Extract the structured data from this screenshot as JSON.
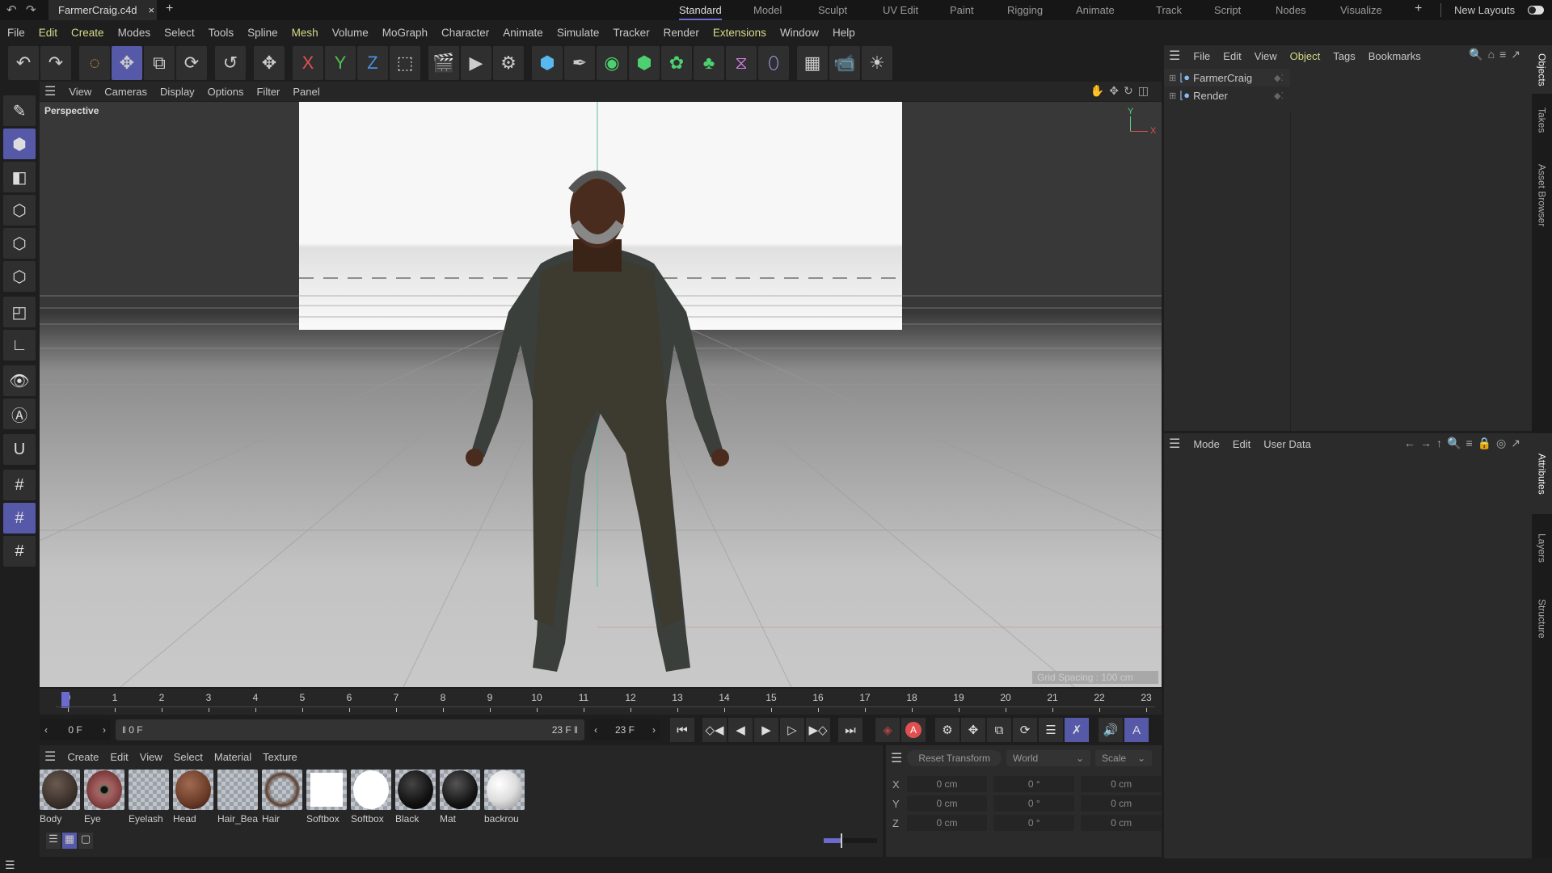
{
  "title_bar": {
    "document_tab": "FarmerCraig.c4d",
    "close": "×",
    "add": "+",
    "layouts": [
      {
        "label": "Standard",
        "active": true
      },
      {
        "label": "Model"
      },
      {
        "label": "Sculpt"
      },
      {
        "label": "UV Edit"
      },
      {
        "label": "Paint"
      },
      {
        "label": "Rigging"
      },
      {
        "label": "Animate"
      },
      {
        "label": "Track"
      },
      {
        "label": "Script"
      },
      {
        "label": "Nodes"
      },
      {
        "label": "Visualize"
      }
    ],
    "add_layout": "+",
    "new_layouts": "New Layouts"
  },
  "menu": [
    {
      "label": "File"
    },
    {
      "label": "Edit",
      "hl": true
    },
    {
      "label": "Create",
      "hl": true
    },
    {
      "label": "Modes"
    },
    {
      "label": "Select"
    },
    {
      "label": "Tools"
    },
    {
      "label": "Spline"
    },
    {
      "label": "Mesh",
      "hl": true
    },
    {
      "label": "Volume"
    },
    {
      "label": "MoGraph"
    },
    {
      "label": "Character"
    },
    {
      "label": "Animate"
    },
    {
      "label": "Simulate"
    },
    {
      "label": "Tracker"
    },
    {
      "label": "Render"
    },
    {
      "label": "Extensions",
      "hl": true
    },
    {
      "label": "Window"
    },
    {
      "label": "Help"
    }
  ],
  "toolbar": [
    [
      {
        "icon": "undo-icon",
        "g": "↶"
      },
      {
        "icon": "redo-icon",
        "g": "↷"
      }
    ],
    [
      {
        "icon": "live-selection-icon",
        "g": "◌",
        "c": "#e0a040"
      },
      {
        "icon": "move-icon",
        "g": "✥",
        "on": true
      },
      {
        "icon": "scale-icon",
        "g": "⧉"
      },
      {
        "icon": "rotate-icon",
        "g": "⟳"
      }
    ],
    [
      {
        "icon": "recent-tool-icon",
        "g": "↺"
      }
    ],
    [
      {
        "icon": "transform-icon",
        "g": "✥"
      }
    ],
    [
      {
        "icon": "x-axis-icon",
        "g": "X",
        "c": "#e05050"
      },
      {
        "icon": "y-axis-icon",
        "g": "Y",
        "c": "#50c050"
      },
      {
        "icon": "z-axis-icon",
        "g": "Z",
        "c": "#4a90e0"
      },
      {
        "icon": "coordinate-system-icon",
        "g": "⬚"
      }
    ],
    [
      {
        "icon": "render-view-icon",
        "g": "🎬"
      },
      {
        "icon": "render-picture-viewer-icon",
        "g": "▶"
      },
      {
        "icon": "render-settings-icon",
        "g": "⚙"
      }
    ],
    [
      {
        "icon": "cube-icon",
        "g": "⬢",
        "c": "#5ab8f0"
      },
      {
        "icon": "pen-spline-icon",
        "g": "✒"
      },
      {
        "icon": "subdivision-icon",
        "g": "◉",
        "c": "#4cd070"
      },
      {
        "icon": "extrude-icon",
        "g": "⬢",
        "c": "#4cd070"
      },
      {
        "icon": "cloner-icon",
        "g": "✿",
        "c": "#4cd070"
      },
      {
        "icon": "volume-icon",
        "g": "♣",
        "c": "#4cd070"
      },
      {
        "icon": "deformer-icon",
        "g": "⧖",
        "c": "#d080e0"
      },
      {
        "icon": "field-icon",
        "g": "⬯",
        "c": "#a0a0f0"
      }
    ],
    [
      {
        "icon": "floor-icon",
        "g": "▦"
      },
      {
        "icon": "camera-icon",
        "g": "📹"
      },
      {
        "icon": "light-icon",
        "g": "☀"
      }
    ]
  ],
  "left_tools": [
    {
      "icon": "make-editable-icon",
      "g": "✎"
    },
    {
      "icon": "model-mode-icon",
      "g": "⬢",
      "on": true
    },
    {
      "icon": "texture-mode-icon",
      "g": "◧"
    },
    {
      "icon": "points-mode-icon",
      "g": "⬡"
    },
    {
      "icon": "edges-mode-icon",
      "g": "⬡"
    },
    {
      "icon": "polygons-mode-icon",
      "g": "⬡"
    },
    {
      "icon": "uv-mode-icon",
      "g": "◰"
    },
    {
      "icon": "axis-mode-icon",
      "g": "∟"
    },
    {
      "icon": "solo-icon",
      "g": "👁"
    },
    {
      "icon": "tweak-icon",
      "g": "Ⓐ"
    },
    {
      "icon": "snap-icon",
      "g": "U"
    },
    {
      "icon": "workplane-icon",
      "g": "#"
    },
    {
      "icon": "lock-workplane-icon",
      "g": "#",
      "on": true
    },
    {
      "icon": "align-workplane-icon",
      "g": "#"
    }
  ],
  "viewport": {
    "menu": [
      "View",
      "Cameras",
      "Display",
      "Options",
      "Filter",
      "Panel"
    ],
    "camera": "Perspective",
    "grid_spacing": "Grid Spacing : 100 cm",
    "axis_y": "Y",
    "axis_x": "X"
  },
  "timeline": {
    "frames": [
      0,
      1,
      2,
      3,
      4,
      5,
      6,
      7,
      8,
      9,
      10,
      11,
      12,
      13,
      14,
      15,
      16,
      17,
      18,
      19,
      20,
      21,
      22,
      23
    ],
    "current_frame": 0,
    "current": "0 F",
    "range_start": "0 F",
    "range_end": "23 F",
    "end": "23 F"
  },
  "materials": {
    "menu": [
      "Create",
      "Edit",
      "View",
      "Select",
      "Material",
      "Texture"
    ],
    "items": [
      {
        "name": "Body",
        "color": "radial-gradient(circle at 40% 35%,#6a5a50,#3a302a 60%,#1a1410)"
      },
      {
        "name": "Eye",
        "color": "radial-gradient(circle,#111 12%,#807060 16%,#a46060 30%,#7a3a3a 70%)"
      },
      {
        "name": "Eyelash",
        "color": "transparent"
      },
      {
        "name": "Head",
        "color": "radial-gradient(circle at 40% 35%,#a06a50,#6a3a28 60%,#2a1810)"
      },
      {
        "name": "Hair_Bea",
        "color": "transparent"
      },
      {
        "name": "Hair",
        "color": "radial-gradient(circle,transparent 40%,#5a4030 60%,transparent 72%)"
      },
      {
        "name": "Softbox",
        "color": "#fff",
        "square": true
      },
      {
        "name": "Softbox",
        "color": "#fff"
      },
      {
        "name": "Black",
        "color": "radial-gradient(circle at 40% 35%,#444,#111 60%,#000)"
      },
      {
        "name": "Mat",
        "color": "radial-gradient(circle at 40% 35%,#555,#151515 60%,#000)"
      },
      {
        "name": "backrou",
        "color": "radial-gradient(circle at 35% 35%,#fff,#ddd 50%,#888)"
      }
    ]
  },
  "coordinates": {
    "reset": "Reset Transform",
    "space": "World",
    "mode": "Scale",
    "rows": [
      {
        "axis": "X",
        "pos": "0 cm",
        "rot": "0 °",
        "scale": "0 cm"
      },
      {
        "axis": "Y",
        "pos": "0 cm",
        "rot": "0 °",
        "scale": "0 cm"
      },
      {
        "axis": "Z",
        "pos": "0 cm",
        "rot": "0 °",
        "scale": "0 cm"
      }
    ]
  },
  "objects": {
    "menu": [
      {
        "label": "File"
      },
      {
        "label": "Edit"
      },
      {
        "label": "View"
      },
      {
        "label": "Object",
        "hl": true
      },
      {
        "label": "Tags"
      },
      {
        "label": "Bookmarks"
      }
    ],
    "items": [
      "FarmerCraig",
      "Render"
    ]
  },
  "attributes": {
    "menu": [
      "Mode",
      "Edit",
      "User Data"
    ]
  },
  "side_tabs": {
    "top": [
      "Objects",
      "Takes",
      "Asset Browser"
    ],
    "bottom": [
      "Attributes",
      "Layers",
      "Structure"
    ]
  },
  "colors": {
    "accent": "#5659a8",
    "highlight_menu": "#d6d98a"
  }
}
